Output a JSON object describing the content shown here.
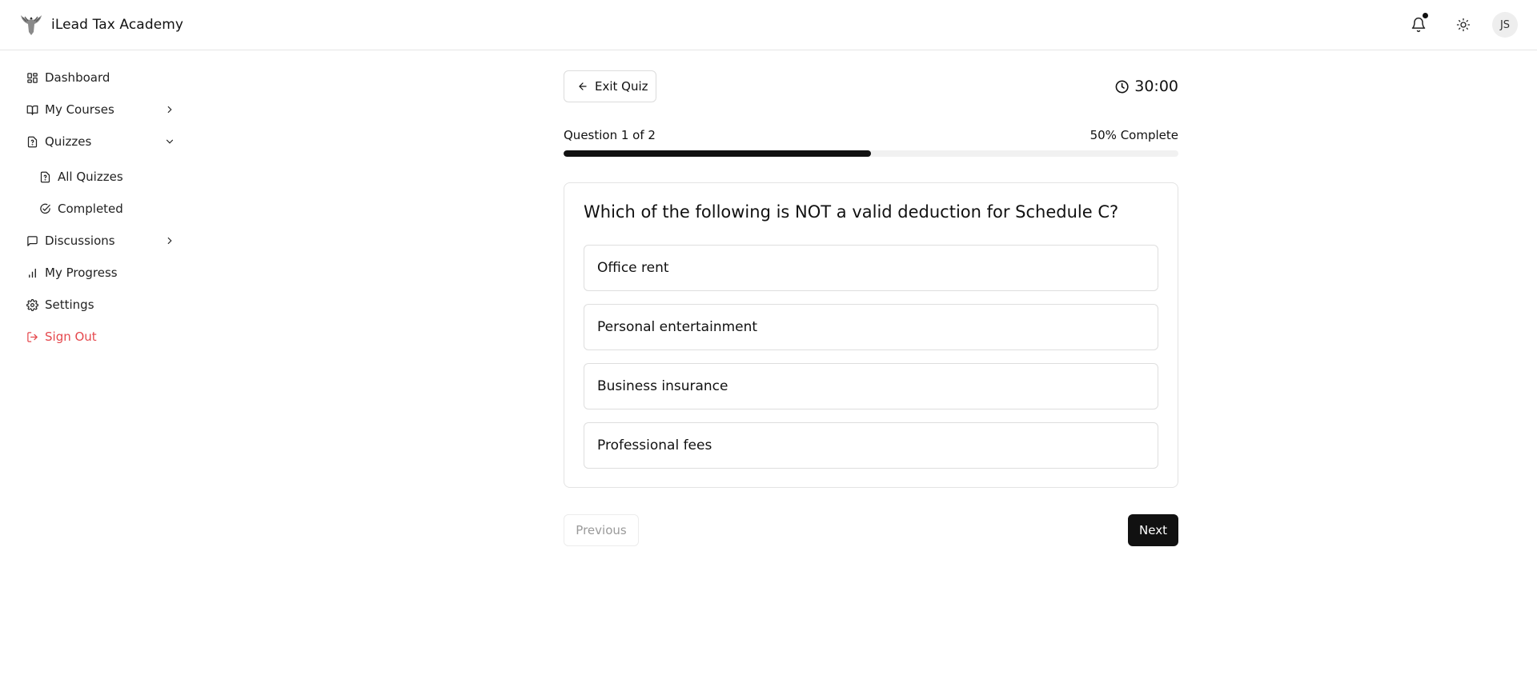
{
  "app": {
    "title": "iLead Tax Academy",
    "logo_icon": "eagle-logo-icon",
    "notification_icon": "bell-icon",
    "notification_has_unread": true,
    "theme_icon": "sun-icon",
    "avatar_initials": "JS"
  },
  "sidebar": {
    "items": [
      {
        "label": "Dashboard",
        "icon": "dashboard-icon"
      },
      {
        "label": "My Courses",
        "icon": "book-icon",
        "expandable": true,
        "expanded": false
      },
      {
        "label": "Quizzes",
        "icon": "quiz-file-icon",
        "expandable": true,
        "expanded": true
      },
      {
        "label": "All Quizzes",
        "icon": "quiz-file-icon",
        "sub": true
      },
      {
        "label": "Completed",
        "icon": "check-circle-icon",
        "sub": true
      },
      {
        "label": "Discussions",
        "icon": "message-square-icon",
        "expandable": true,
        "expanded": false
      },
      {
        "label": "My Progress",
        "icon": "bar-chart-icon"
      },
      {
        "label": "Settings",
        "icon": "gear-icon"
      },
      {
        "label": "Sign Out",
        "icon": "log-out-icon",
        "danger": true
      }
    ]
  },
  "quiz": {
    "exit_label": "Exit Quiz",
    "timer": "30:00",
    "progress_text": "Question 1 of 2",
    "progress_percent_text": "50% Complete",
    "progress_fraction": 0.5,
    "question": "Which of the following is NOT a valid deduction for Schedule C?",
    "options": [
      "Office rent",
      "Personal entertainment",
      "Business insurance",
      "Professional fees"
    ],
    "previous_label": "Previous",
    "next_label": "Next"
  },
  "colors": {
    "accent": "#111111",
    "danger": "#e5484d",
    "border": "#e3e3e3",
    "progress_track": "#f1f1f1"
  }
}
